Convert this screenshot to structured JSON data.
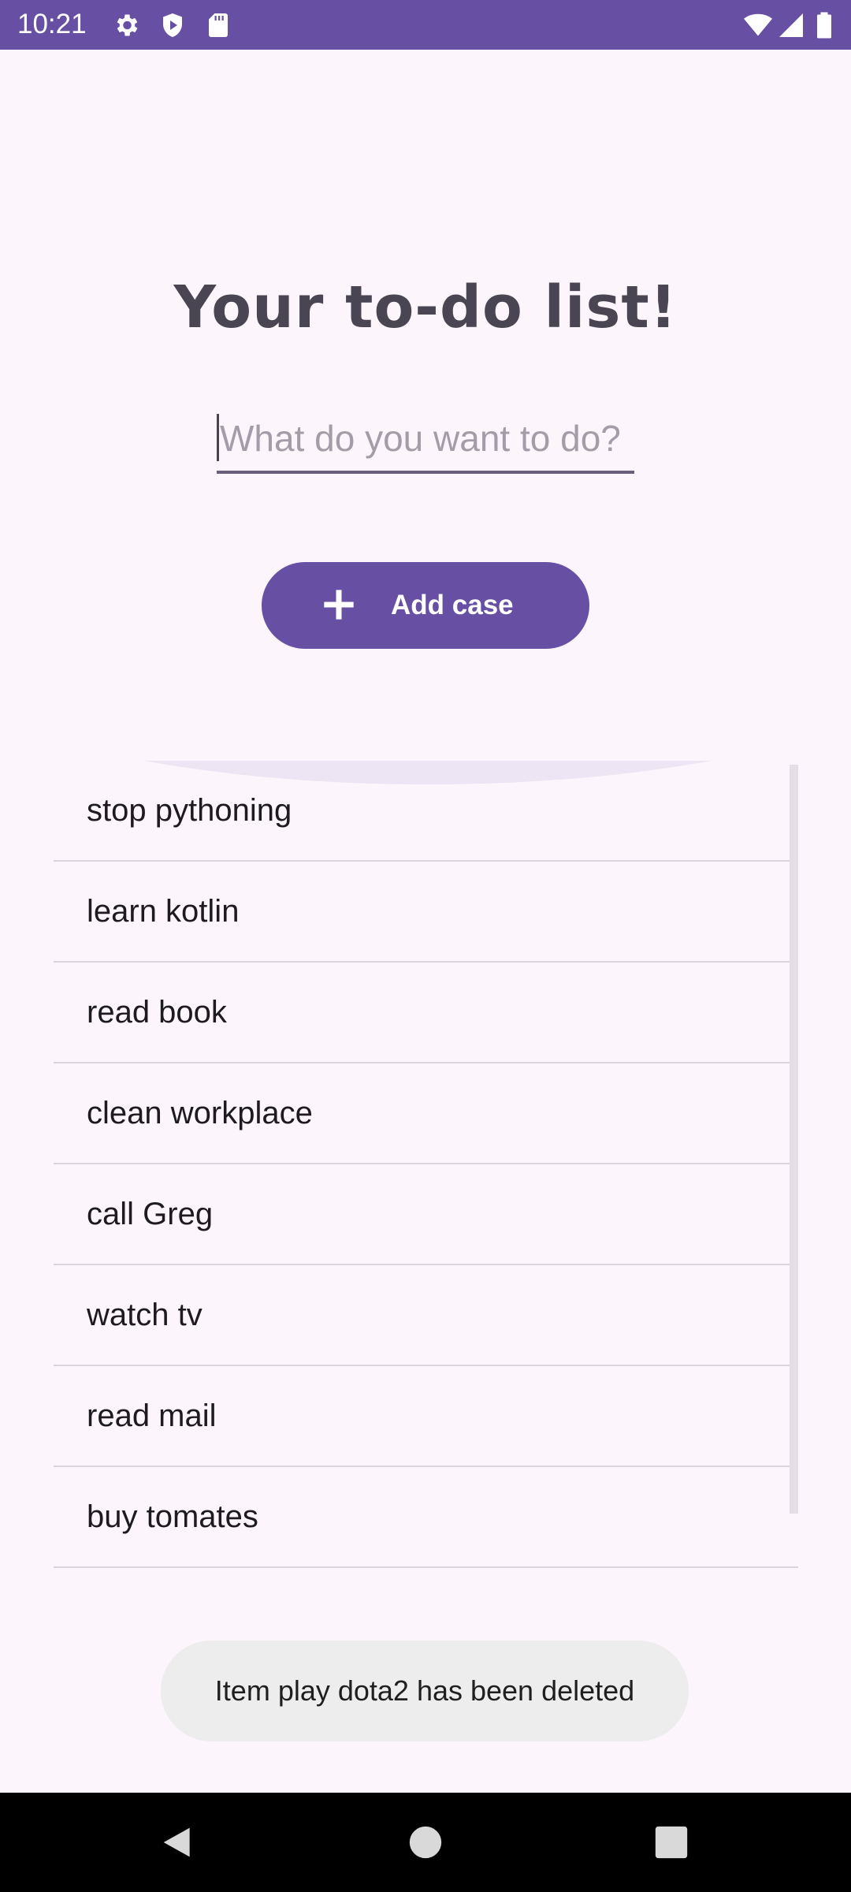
{
  "status_bar": {
    "time": "10:21",
    "icons": [
      "gear-icon",
      "shield-icon",
      "sd-card-icon",
      "wifi-icon",
      "signal-icon",
      "battery-icon"
    ],
    "background": "#6750a4"
  },
  "title": "Your to-do list!",
  "input": {
    "placeholder": "What do you want to do?",
    "value": ""
  },
  "add_button": {
    "icon": "plus-icon",
    "label": "Add case",
    "color": "#6750a4"
  },
  "todo_items": [
    "stop pythoning",
    "learn kotlin",
    "read book",
    "clean workplace",
    "call Greg",
    "watch tv",
    "read mail",
    "buy tomates"
  ],
  "toast": "Item play dota2 has been deleted",
  "nav_bar": {
    "buttons": [
      "back-icon",
      "home-icon",
      "recents-icon"
    ]
  }
}
